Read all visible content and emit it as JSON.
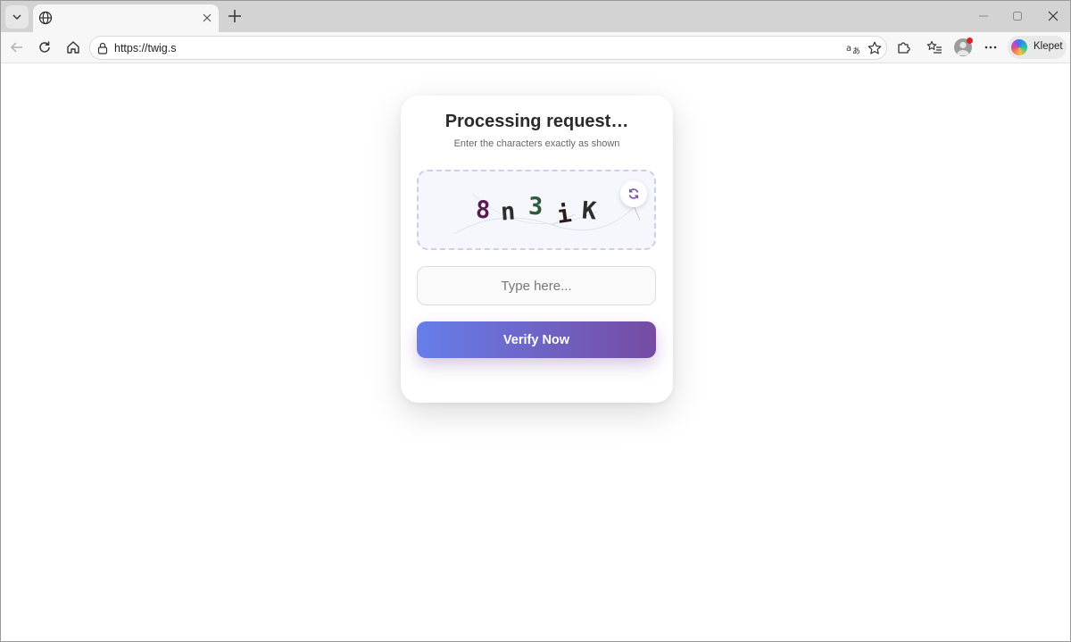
{
  "browser": {
    "url": "https://twig.s",
    "profile_label": "Klepet",
    "tab_title": ""
  },
  "icons": {
    "tab_menu": "chevron-down-icon",
    "tab_favicon": "globe-icon",
    "tab_close": "close-icon",
    "new_tab": "plus-icon",
    "back": "arrow-left-icon",
    "refresh": "refresh-icon",
    "home": "home-icon",
    "lock": "lock-icon",
    "translate": "translate-icon",
    "favorite": "star-icon",
    "extensions": "puzzle-icon",
    "favorites_bar": "favorites-list-icon",
    "more": "more-icon",
    "captcha_refresh": "refresh-icon"
  },
  "captcha": {
    "title": "Processing request…",
    "subtitle": "Enter the characters exactly as shown",
    "characters": [
      "8",
      "n",
      "3",
      "i",
      "K"
    ],
    "character_colors": [
      "#5a1a52",
      "#2d2d2d",
      "#2f5a3a",
      "#2a1a1a",
      "#2d2d2d"
    ],
    "input_placeholder": "Type here...",
    "input_value": "",
    "submit_label": "Verify Now"
  },
  "colors": {
    "button_gradient_start": "#667eea",
    "button_gradient_end": "#764ba2",
    "captcha_border": "#cbd0e6",
    "refresh_icon": "#7b4fa8"
  }
}
